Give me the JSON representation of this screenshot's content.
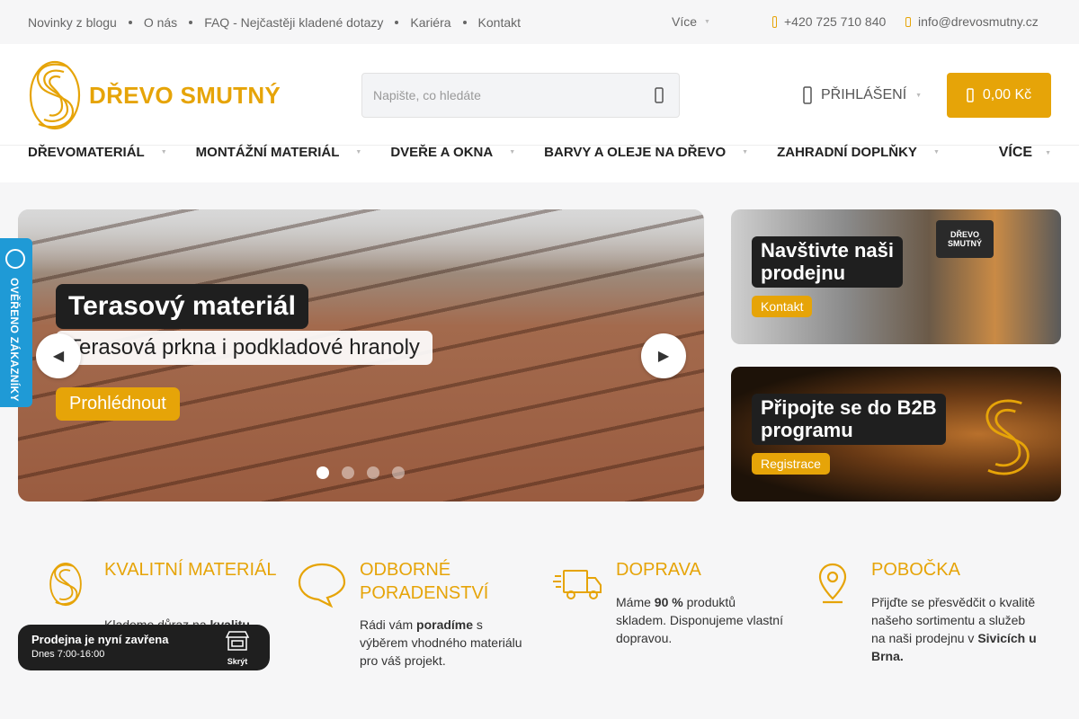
{
  "topbar": {
    "links": [
      "Novinky z blogu",
      "O nás",
      "FAQ - Nejčastěji kladené dotazy",
      "Kariéra",
      "Kontakt"
    ],
    "more_label": "Více",
    "phone": "+420 725 710 840",
    "email": "info@drevosmutny.cz"
  },
  "header": {
    "logo_text": "DŘEVO SMUTNÝ",
    "search_placeholder": "Napište, co hledáte",
    "login_label": "PŘIHLÁŠENÍ",
    "cart_total": "0,00 Kč"
  },
  "nav": {
    "items": [
      "DŘEVOMATERIÁL",
      "MONTÁŽNÍ MATERIÁL",
      "DVEŘE A OKNA",
      "BARVY A OLEJE NA DŘEVO",
      "ZAHRADNÍ DOPLŇKY"
    ],
    "more_label": "VÍCE"
  },
  "slider": {
    "title": "Terasový materiál",
    "subtitle": "Terasová prkna i podkladové hranoly",
    "button": "Prohlédnout",
    "dots": 4,
    "active_dot": 1
  },
  "banners": [
    {
      "title_line1": "Navštivte naši",
      "title_line2": "prodejnu",
      "button": "Kontakt",
      "sign_text": "DŘEVO SMUTNÝ"
    },
    {
      "title_line1": "Připojte se do B2B",
      "title_line2": "programu",
      "button": "Registrace"
    }
  ],
  "side_badge": {
    "text": "OVĚŘENO ZÁKAZNÍKY"
  },
  "features": [
    {
      "title": "KVALITNÍ MATERIÁL",
      "text_pre": "Klademe důraz na ",
      "text_bold": "kvalitu",
      "text_post": ""
    },
    {
      "title": "ODBORNÉ PORADENSTVÍ",
      "text_pre": "Rádi vám ",
      "text_bold": "poradíme",
      "text_post": " s výběrem vhodného materiálu pro váš projekt."
    },
    {
      "title": "DOPRAVA",
      "text_pre": "Máme ",
      "text_bold": "90 %",
      "text_post": " produktů skladem. Disponujeme vlastní dopravou."
    },
    {
      "title": "POBOČKA",
      "text_pre": "Přijďte se přesvědčit o kvalitě našeho sortimentu a služeb na naši prodejnu v ",
      "text_bold": "Sivicích u Brna.",
      "text_post": ""
    }
  ],
  "shop_status": {
    "title": "Prodejna je nyní zavřena",
    "hours": "Dnes 7:00-16:00",
    "hide_label": "Skrýt"
  },
  "colors": {
    "accent": "#e6a408",
    "dark": "#1f1f1f",
    "badge_blue": "#1f9ad6",
    "background": "#f6f6f7"
  }
}
